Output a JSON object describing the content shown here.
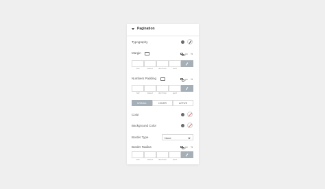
{
  "section": {
    "title": "Pagination"
  },
  "typography": {
    "label": "Typography"
  },
  "margin": {
    "label": "Margin",
    "unit": "px",
    "unit_alt": "%",
    "fields": {
      "top": "TOP",
      "right": "RIGHT",
      "bottom": "BOTTOM",
      "left": "LEFT"
    }
  },
  "numbers_padding": {
    "label": "Numbers Padding",
    "unit": "px",
    "unit_alt": "%",
    "fields": {
      "top": "TOP",
      "right": "RIGHT",
      "bottom": "BOTTOM",
      "left": "LEFT"
    }
  },
  "state_tabs": {
    "normal": "NORMAL",
    "hover": "HOVER",
    "active": "ACTIVE",
    "selected": "normal"
  },
  "color": {
    "label": "Color"
  },
  "background_color": {
    "label": "Background Color"
  },
  "border_type": {
    "label": "Border Type",
    "value": "None"
  },
  "border_radius": {
    "label": "Border Radius",
    "unit": "px",
    "unit_alt": "%",
    "fields": {
      "top": "TOP",
      "right": "RIGHT",
      "bottom": "BOTTOM",
      "left": "LEFT"
    }
  },
  "theme": {
    "accent": "#a4afb7",
    "clear_color": "#e06b6b"
  }
}
